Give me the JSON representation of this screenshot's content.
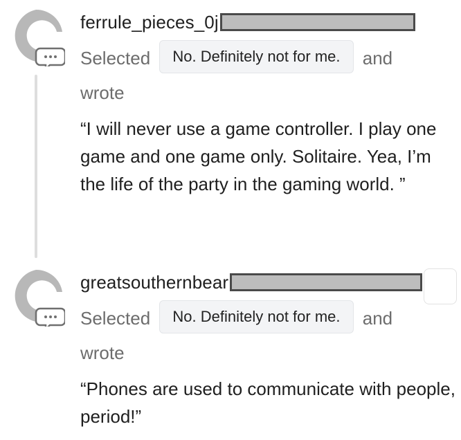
{
  "comments": [
    {
      "username": "ferrule_pieces_0j",
      "selected_word": "Selected",
      "choice": "No. Definitely not for me.",
      "and_word": "and",
      "wrote_word": "wrote",
      "quote": "“I will never use a game controller. I play one game and one game only. Solitaire. Yea, I’m the life of the party in the gaming world. ”"
    },
    {
      "username": "greatsouthernbear",
      "selected_word": "Selected",
      "choice": "No. Definitely not for me.",
      "and_word": "and",
      "wrote_word": "wrote",
      "quote": "“Phones are used to communicate with people, period!”"
    }
  ],
  "icons": {
    "avatar": "default-avatar-icon",
    "badge": "comment-bubble-icon"
  },
  "colors": {
    "avatar_gray": "#b8b8b8",
    "chip_background": "#f3f4f6",
    "muted_text": "#6c6c6c",
    "thread_line": "#dedede"
  }
}
